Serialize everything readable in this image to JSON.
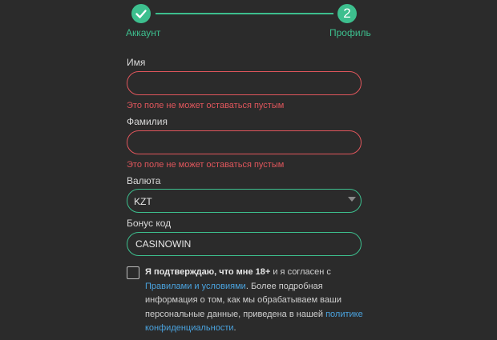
{
  "stepper": {
    "step1_label": "Аккаунт",
    "step1_icon": "check-icon",
    "step2_number": "2",
    "step2_label": "Профиль",
    "accent": "#3dbf8e"
  },
  "form": {
    "first_name": {
      "label": "Имя",
      "value": "",
      "error": "Это поле не может оставаться пустым"
    },
    "last_name": {
      "label": "Фамилия",
      "value": "",
      "error": "Это поле не может оставаться пустым"
    },
    "currency": {
      "label": "Валюта",
      "value": "KZT"
    },
    "bonus_code": {
      "label": "Бонус код",
      "value": "CASINOWIN"
    },
    "error_color": "#e0565c"
  },
  "terms": {
    "bold": "Я подтверждаю, что мне 18+",
    "text1": " и я согласен с ",
    "link1": "Правилами и условиями",
    "text2": ". Более подробная информация о том, как мы обрабатываем ваши персональные данные, приведена в нашей ",
    "link2": "политике конфиденциальности",
    "text3": ".",
    "link_color": "#4aa3df"
  }
}
